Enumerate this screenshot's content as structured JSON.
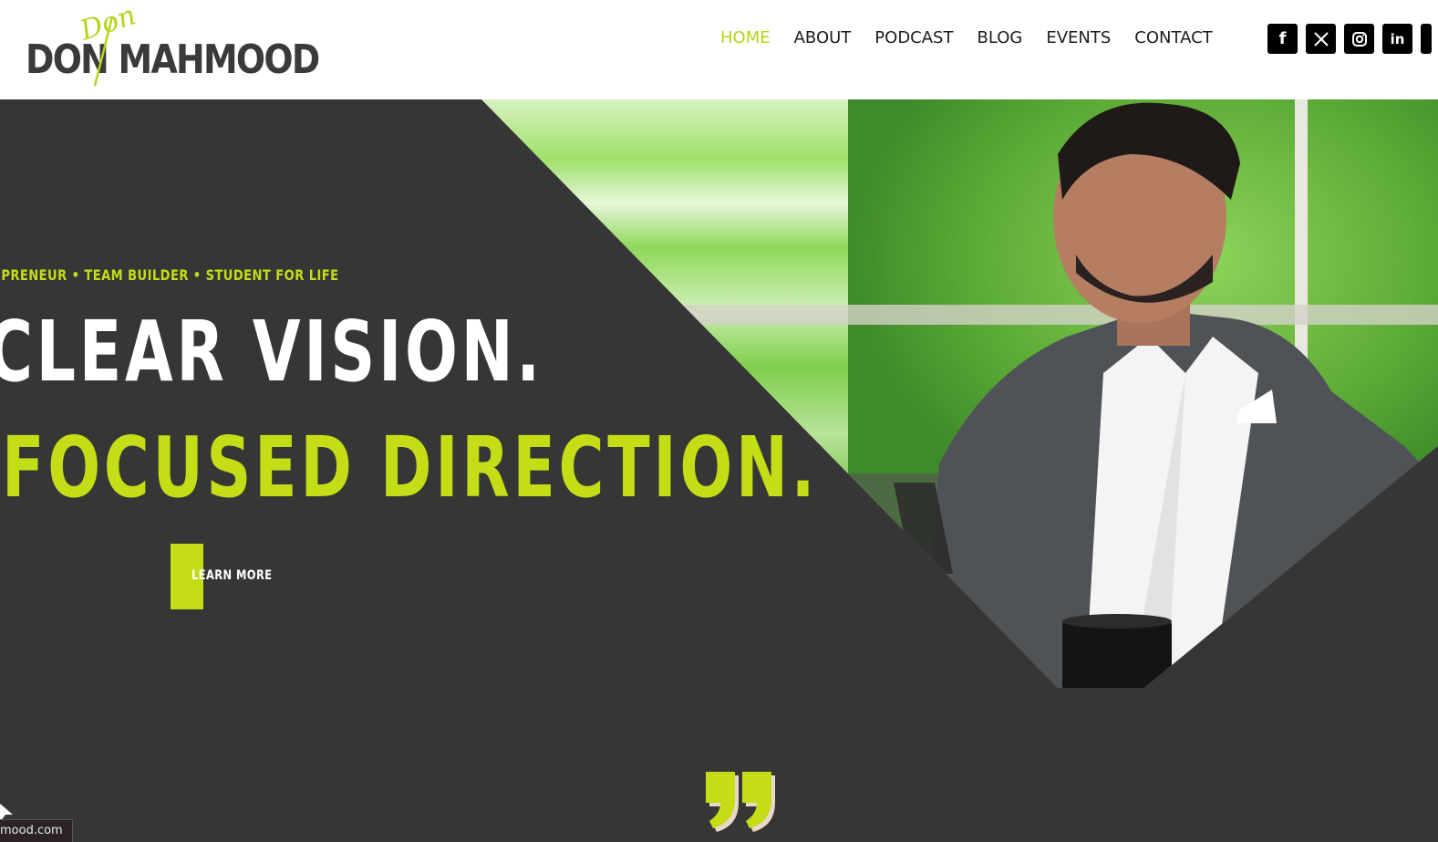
{
  "logo": {
    "script_text": "Don",
    "main_text": "DON MAHMOOD"
  },
  "nav": {
    "items": [
      {
        "label": "HOME",
        "active": true
      },
      {
        "label": "ABOUT",
        "active": false
      },
      {
        "label": "PODCAST",
        "active": false
      },
      {
        "label": "BLOG",
        "active": false
      },
      {
        "label": "EVENTS",
        "active": false
      },
      {
        "label": "CONTACT",
        "active": false
      }
    ]
  },
  "social": [
    {
      "icon": "facebook-icon",
      "glyph": "f"
    },
    {
      "icon": "x-twitter-icon",
      "glyph": "𝕏"
    },
    {
      "icon": "instagram-icon",
      "glyph": "◎"
    },
    {
      "icon": "linkedin-icon",
      "glyph": "in"
    }
  ],
  "hero": {
    "tagline": "EPRENEUR • TEAM BUILDER • STUDENT FOR LIFE",
    "headline_line1": "CLEAR VISION.",
    "headline_line2": "FOCUSED DIRECTION.",
    "cta_label": "LEARN MORE"
  },
  "status_bar": {
    "url_fragment": "mood.com"
  },
  "colors": {
    "accent": "#c5dd16",
    "dark_bg": "#363636",
    "header_bg": "#ffffff",
    "nav_text": "#1c1c1c"
  }
}
